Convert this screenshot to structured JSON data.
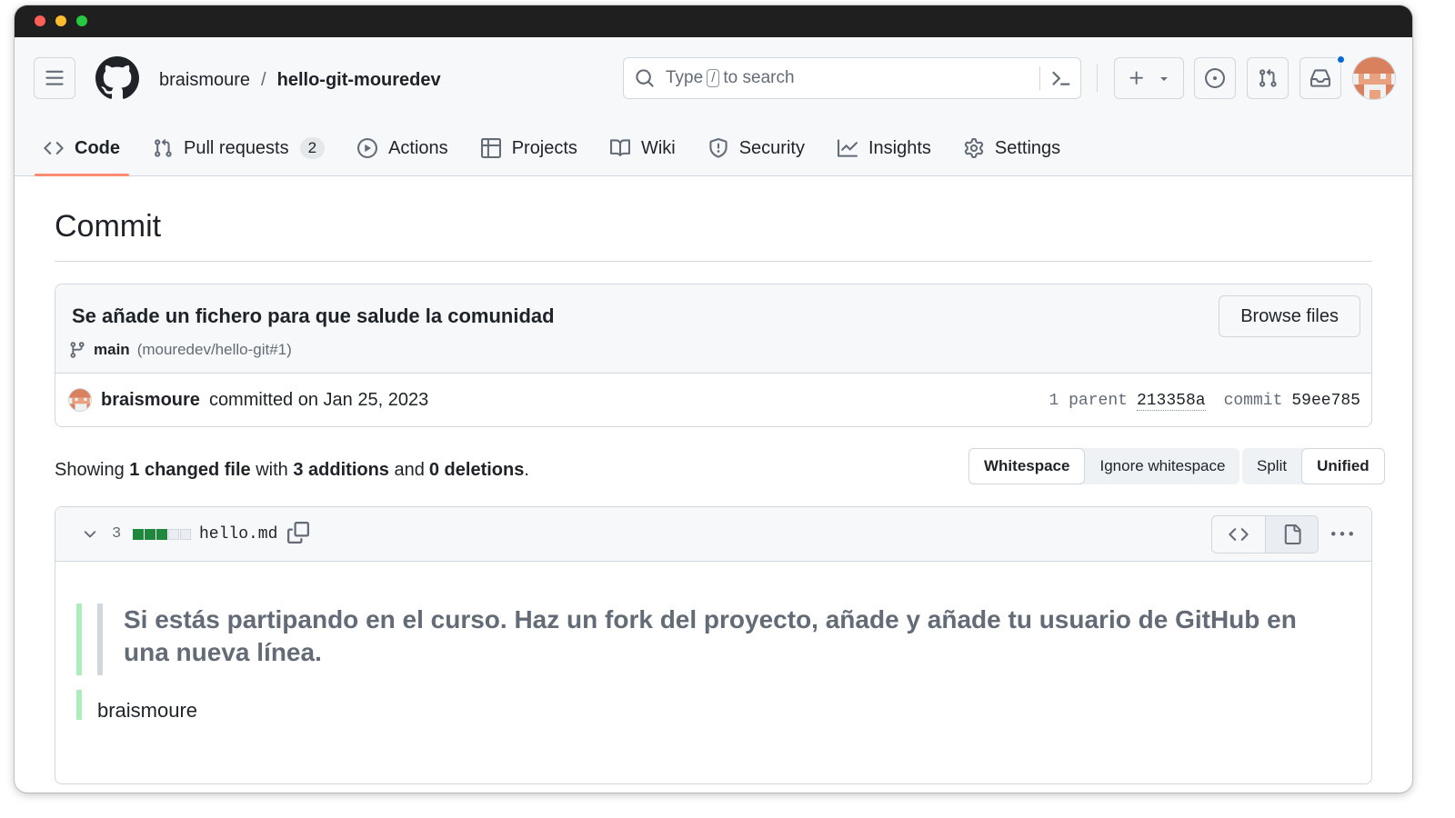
{
  "header": {
    "owner": "braismoure",
    "separator": "/",
    "repo": "hello-git-mouredev",
    "search": {
      "prefix": "Type",
      "key": "/",
      "suffix": "to search"
    }
  },
  "tabs": [
    {
      "label": "Code",
      "active": true
    },
    {
      "label": "Pull requests",
      "count": "2"
    },
    {
      "label": "Actions"
    },
    {
      "label": "Projects"
    },
    {
      "label": "Wiki"
    },
    {
      "label": "Security"
    },
    {
      "label": "Insights"
    },
    {
      "label": "Settings"
    }
  ],
  "page": {
    "title": "Commit"
  },
  "commit": {
    "message": "Se añade un fichero para que salude la comunidad",
    "branch": "main",
    "pr_ref": "(mouredev/hello-git#1)",
    "browse_label": "Browse files",
    "author": "braismoure",
    "committed_text": "committed on Jan 25, 2023",
    "parent_label": "1 parent",
    "parent_sha": "213358a",
    "commit_label": "commit",
    "commit_sha": "59ee785"
  },
  "summary": {
    "showing": "Showing",
    "changed": "1 changed file",
    "with": "with",
    "additions": "3 additions",
    "and": "and",
    "deletions": "0 deletions",
    "period": "."
  },
  "whitespace_options": {
    "whitespace": "Whitespace",
    "ignore": "Ignore whitespace",
    "selected": "Whitespace"
  },
  "view_options": {
    "split": "Split",
    "unified": "Unified",
    "selected": "Unified"
  },
  "file": {
    "change_count": "3",
    "diffstat": {
      "added": 3,
      "removed": 0,
      "neutral": 2
    },
    "name": "hello.md",
    "view_selected": "rich"
  },
  "diff_content": {
    "quote": "Si estás partipando en el curso. Haz un fork del proyecto, añade y añade tu usuario de GitHub en una nueva línea.",
    "line": "braismoure"
  },
  "colors": {
    "accent_underline": "#fd8c73",
    "added": "#1f883d",
    "added_bar": "#aceebb",
    "notification_dot": "#0969da"
  },
  "icons": [
    "hamburger-icon",
    "github-logo",
    "search-icon",
    "command-palette-icon",
    "plus-icon",
    "triangle-down-icon",
    "issue-opened-icon",
    "git-pull-request-icon",
    "inbox-icon",
    "code-icon",
    "play-icon",
    "table-icon",
    "book-icon",
    "shield-icon",
    "graph-icon",
    "gear-icon",
    "git-branch-icon",
    "chevron-down-icon",
    "copy-icon",
    "file-icon",
    "kebab-horizontal-icon"
  ]
}
